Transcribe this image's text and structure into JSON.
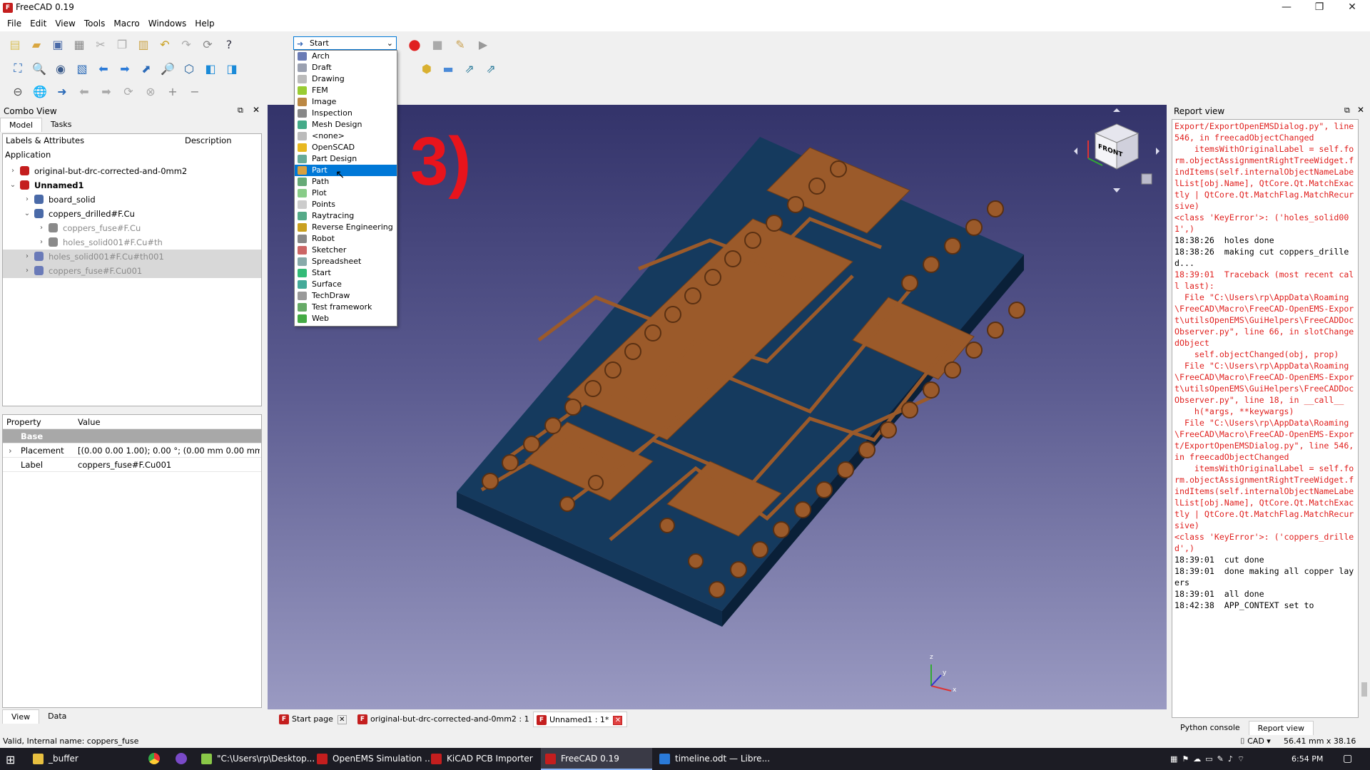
{
  "window": {
    "title": "FreeCAD 0.19",
    "minimize": "—",
    "restore": "❐",
    "close": "✕"
  },
  "menu": [
    "File",
    "Edit",
    "View",
    "Tools",
    "Macro",
    "Windows",
    "Help"
  ],
  "workbench_combo": {
    "value": "Start"
  },
  "workbench_list": {
    "items": [
      "Arch",
      "Draft",
      "Drawing",
      "FEM",
      "Image",
      "Inspection",
      "Mesh Design",
      "<none>",
      "OpenSCAD",
      "Part Design",
      "Part",
      "Path",
      "Plot",
      "Points",
      "Raytracing",
      "Reverse Engineering",
      "Robot",
      "Sketcher",
      "Spreadsheet",
      "Start",
      "Surface",
      "TechDraw",
      "Test framework",
      "Web"
    ],
    "highlighted": "Part",
    "icon_colors": [
      "#6a7bb5",
      "#9aa0b0",
      "#bbb",
      "#9c3",
      "#b84",
      "#888",
      "#4a8",
      "#bbb",
      "#e8b820",
      "#6a9",
      "#d8a040",
      "#6a7",
      "#8c8",
      "#ccc",
      "#5a8",
      "#c9a020",
      "#888",
      "#c66",
      "#8aa",
      "#3b7",
      "#4a9",
      "#999",
      "#6a6",
      "#4a4"
    ]
  },
  "combo_view": {
    "title": "Combo View",
    "tabs": [
      "Model",
      "Tasks"
    ],
    "tree_headers": [
      "Labels & Attributes",
      "Description"
    ],
    "tree_root": "Application",
    "tree": [
      {
        "label": "original-but-drc-corrected-and-0mm2",
        "style": "normal",
        "chev": "›"
      },
      {
        "label": "Unnamed1",
        "style": "bold",
        "chev": "⌄"
      },
      {
        "label": "board_solid",
        "style": "normal",
        "chev": "›"
      },
      {
        "label": "coppers_drilled#F.Cu",
        "style": "normal",
        "chev": "⌄"
      },
      {
        "label": "coppers_fuse#F.Cu",
        "style": "gray",
        "chev": "›"
      },
      {
        "label": "holes_solid001#F.Cu#th",
        "style": "gray",
        "chev": "›"
      },
      {
        "label": "holes_solid001#F.Cu#th001",
        "style": "gray-sel",
        "chev": "›"
      },
      {
        "label": "coppers_fuse#F.Cu001",
        "style": "gray-sel",
        "chev": "›"
      }
    ],
    "prop_headers": [
      "Property",
      "Value"
    ],
    "prop_group": "Base",
    "props": [
      {
        "name": "Placement",
        "value": "[(0.00 0.00 1.00); 0.00 °; (0.00 mm  0.00 mm  0...."
      },
      {
        "name": "Label",
        "value": "coppers_fuse#F.Cu001"
      }
    ],
    "bottom_tabs": [
      "View",
      "Data"
    ]
  },
  "overlay": {
    "annotation": "3)"
  },
  "navcube": {
    "face": "FRONT"
  },
  "axis": {
    "z": "z",
    "y": "y",
    "x": "x"
  },
  "report": {
    "title": "Report view",
    "lines": [
      {
        "t": "Export/ExportOpenEMSDialog.py\", line 546, in freecadObjectChanged\n    itemsWithOriginalLabel = self.form.objectAssignmentRightTreeWidget.findItems(self.internalObjectNameLabelList[obj.Name], QtCore.Qt.MatchExactly | QtCore.Qt.MatchFlag.MatchRecursive)\n<class 'KeyError'>: ('holes_solid001',)",
        "k": "err"
      },
      {
        "t": "18:38:26  holes done\n18:38:26  making cut coppers_drilled...",
        "k": "log"
      },
      {
        "t": "18:39:01  Traceback (most recent call last):\n  File \"C:\\Users\\rp\\AppData\\Roaming\\FreeCAD\\Macro\\FreeCAD-OpenEMS-Export\\utilsOpenEMS\\GuiHelpers\\FreeCADDocObserver.py\", line 66, in slotChangedObject\n    self.objectChanged(obj, prop)\n  File \"C:\\Users\\rp\\AppData\\Roaming\\FreeCAD\\Macro\\FreeCAD-OpenEMS-Export\\utilsOpenEMS\\GuiHelpers\\FreeCADDocObserver.py\", line 18, in __call__\n    h(*args, **keywargs)\n  File \"C:\\Users\\rp\\AppData\\Roaming\\FreeCAD\\Macro\\FreeCAD-OpenEMS-Export/ExportOpenEMSDialog.py\", line 546, in freecadObjectChanged\n    itemsWithOriginalLabel = self.form.objectAssignmentRightTreeWidget.findItems(self.internalObjectNameLabelList[obj.Name], QtCore.Qt.MatchExactly | QtCore.Qt.MatchFlag.MatchRecursive)\n<class 'KeyError'>: ('coppers_drilled',)",
        "k": "err"
      },
      {
        "t": "18:39:01  cut done\n18:39:01  done making all copper layers\n18:39:01  all done\n18:42:38  APP_CONTEXT set to",
        "k": "log"
      }
    ],
    "tabs": [
      "Python console",
      "Report view"
    ]
  },
  "doc_tabs": [
    "Start page",
    "original-but-drc-corrected-and-0mm2 : 1",
    "Unnamed1 : 1*"
  ],
  "status": {
    "left": "Valid, Internal name: coppers_fuse",
    "cad": "CAD",
    "dims": "56.41 mm x 38.16 mm"
  },
  "taskbar": {
    "items": [
      "_buffer",
      "\"C:\\Users\\rp\\Desktop...",
      "OpenEMS Simulation ...",
      "KiCAD PCB Importer",
      "FreeCAD 0.19",
      "timeline.odt — Libre..."
    ],
    "clock": "6:54 PM"
  },
  "colors": {
    "accent": "#0078d7",
    "error": "#e0201e",
    "annotation": "#e8141c",
    "copper": "#9b5a2a",
    "board": "#153a5e"
  }
}
